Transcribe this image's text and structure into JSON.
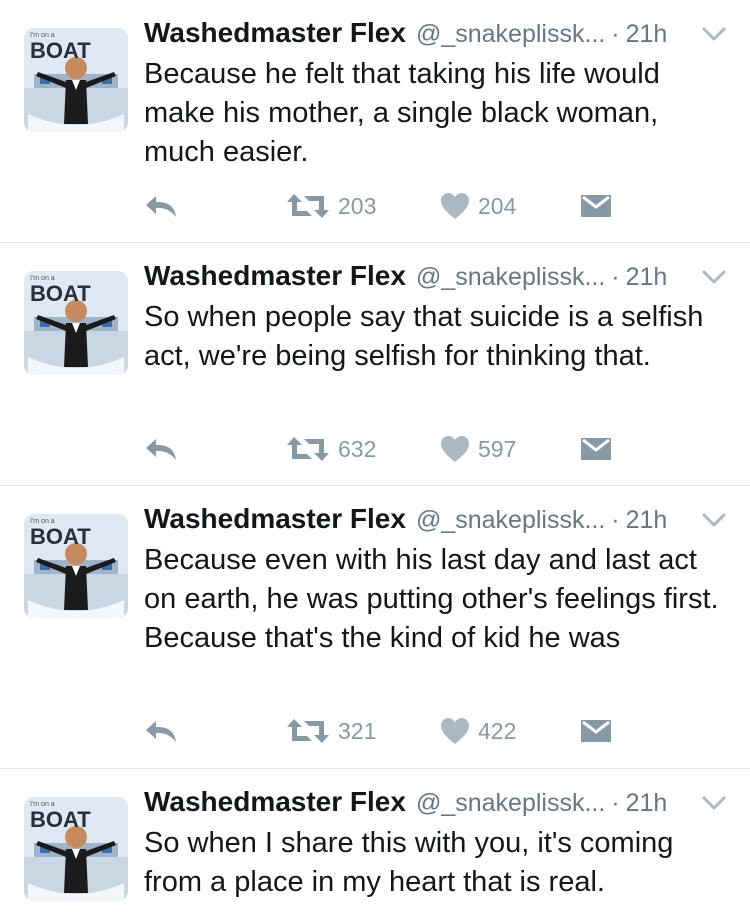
{
  "tweets": [
    {
      "name": "Washedmaster Flex",
      "handle": "@_snakeplissk...",
      "dot": "·",
      "time": "21h",
      "text": "Because he felt that taking his life would make his mother, a single black woman, much easier.",
      "retweets": "203",
      "likes": "204",
      "avatar_text_top": "I'm on a",
      "avatar_text_brand": "BOAT"
    },
    {
      "name": "Washedmaster Flex",
      "handle": "@_snakeplissk...",
      "dot": "·",
      "time": "21h",
      "text": "So when people say that suicide is a selfish act, we're being selfish for thinking that.",
      "retweets": "632",
      "likes": "597",
      "avatar_text_top": "I'm on a",
      "avatar_text_brand": "BOAT"
    },
    {
      "name": "Washedmaster Flex",
      "handle": "@_snakeplissk...",
      "dot": "·",
      "time": "21h",
      "text": "Because even with his last day and last act on earth, he was putting other's feelings first. Because that's the kind of kid he was",
      "retweets": "321",
      "likes": "422",
      "avatar_text_top": "I'm on a",
      "avatar_text_brand": "BOAT"
    },
    {
      "name": "Washedmaster Flex",
      "handle": "@_snakeplissk...",
      "dot": "·",
      "time": "21h",
      "text": "So when I share this with you, it's coming from a place in my heart that is real.",
      "avatar_text_top": "I'm on a",
      "avatar_text_brand": "BOAT"
    }
  ],
  "icons": {
    "reply": "reply-icon",
    "retweet": "retweet-icon",
    "like": "heart-icon",
    "dm": "envelope-icon",
    "caret": "chevron-down-icon"
  },
  "colors": {
    "icon_gray": "#8899a6",
    "divider": "#e1e8ed",
    "text": "#14171a",
    "meta": "#657786"
  }
}
